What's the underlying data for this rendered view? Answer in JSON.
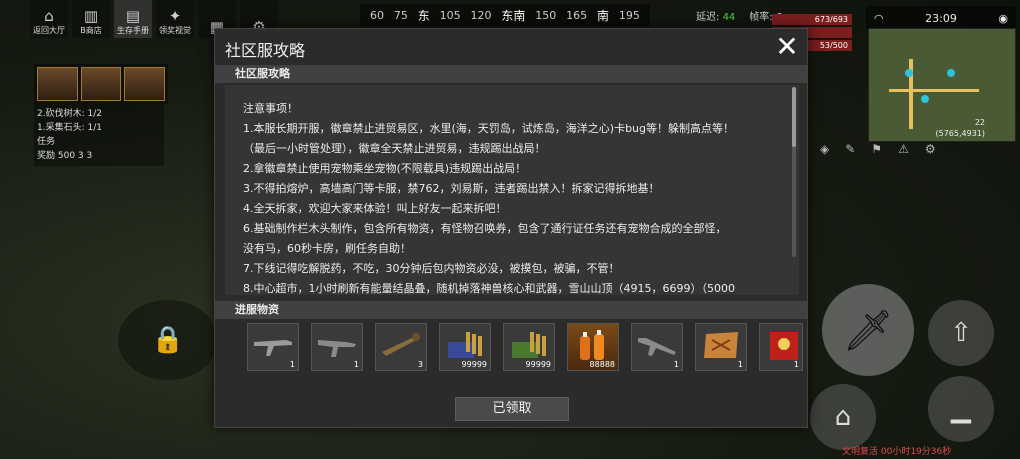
{
  "top_menu": [
    {
      "label": "返回大厅",
      "icon": "home-icon"
    },
    {
      "label": "B商店",
      "icon": "shop-icon"
    },
    {
      "label": "生存手册",
      "icon": "book-icon"
    },
    {
      "label": "领奖视觉",
      "icon": "gift-icon"
    },
    {
      "label": "",
      "icon": "building-icon"
    },
    {
      "label": "",
      "icon": "settings-icon"
    }
  ],
  "compass": [
    "60",
    "75",
    "东",
    "105",
    "120",
    "东南",
    "150",
    "165",
    "南",
    "195"
  ],
  "stats": {
    "latency_label": "延迟:",
    "latency_value": "44",
    "fps_label": "帧率:",
    "fps_value": "6"
  },
  "hud_bars": [
    "673/693",
    "",
    "53/500"
  ],
  "status": {
    "time": "23:09"
  },
  "minimap": {
    "coords": "(5765,4931)",
    "level": "22"
  },
  "quests": [
    "2.砍伐树木: 1/2",
    "1.采集石头: 1/1",
    "任务",
    "奖励 500  3  3"
  ],
  "revive_text": "文明复活 00小时19分36秒",
  "dialog": {
    "title": "社区服攻略",
    "section1": "社区服攻略",
    "notice_lines": [
      "注意事项！",
      "1.本服长期开服，徽章禁止进贸易区，水里(海，天罚岛，试炼岛，海洋之心)卡bug等！躲制高点等！",
      "（最后一小时管处理），徽章全天禁止进贸易，违规踢出战局！",
      "2.拿徽章禁止使用宠物乘坐宠物(不限载具)违规踢出战局！",
      "3.不得拍熔炉，高墙高门等卡服，禁762，刘易斯，违者踢出禁入！拆家记得拆地基！",
      "4.全天拆家，欢迎大家来体验！叫上好友一起来拆吧！",
      "6.基础制作栏木头制作，包含所有物资，有怪物召唤券，包含了通行证任务还有宠物合成的全部怪，",
      "没有马，60秒卡房，刷任务自助！",
      "7.下线记得吃解脱药，不吃，30分钟后包内物资必没，被摸包，被骗，不管！",
      "8.中心超市，1小时刷新有能量结晶叠，随机掉落神兽核心和武器，雪山山顶（4915，6699）（5000"
    ],
    "section2": "进服物资",
    "items": [
      {
        "name": "assault-rifle",
        "count": "1"
      },
      {
        "name": "rifle",
        "count": "1"
      },
      {
        "name": "rpg-launcher",
        "count": "3"
      },
      {
        "name": "blue-ammo",
        "count": "99999"
      },
      {
        "name": "green-ammo",
        "count": "99999"
      },
      {
        "name": "juice-drinks",
        "count": "88888"
      },
      {
        "name": "shotgun",
        "count": "1"
      },
      {
        "name": "treasure-map",
        "count": "1"
      },
      {
        "name": "red-envelope",
        "count": "1"
      }
    ],
    "claim_label": "已领取"
  },
  "colors": {
    "dialog_bg": "#2b2b2b",
    "section_bg": "#414141",
    "latency_green": "#4fd44f",
    "revive_red": "#e04a4a"
  }
}
